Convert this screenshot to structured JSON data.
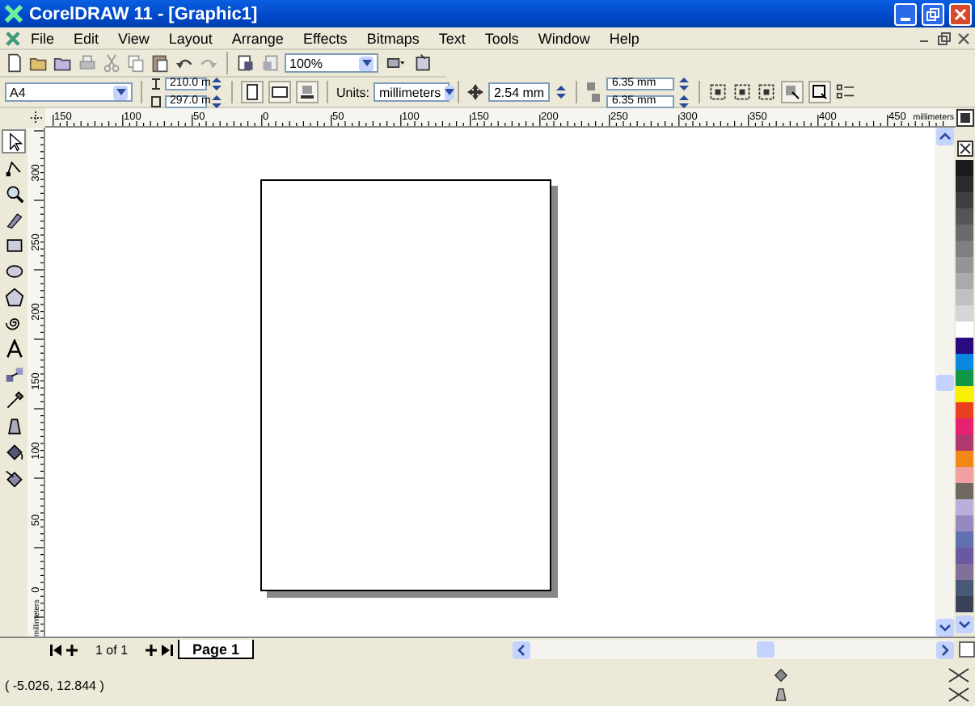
{
  "window": {
    "title": "CorelDRAW 11 - [Graphic1]"
  },
  "menu": [
    {
      "label": "File"
    },
    {
      "label": "Edit"
    },
    {
      "label": "View"
    },
    {
      "label": "Layout"
    },
    {
      "label": "Arrange"
    },
    {
      "label": "Effects"
    },
    {
      "label": "Bitmaps"
    },
    {
      "label": "Text"
    },
    {
      "label": "Tools"
    },
    {
      "label": "Window"
    },
    {
      "label": "Help"
    }
  ],
  "standard_toolbar": {
    "zoom": "100%"
  },
  "property_bar": {
    "paper": "A4",
    "width": "210.0 m",
    "height": "297.0 m",
    "units_label": "Units:",
    "units": "millimeters",
    "nudge": "2.54 mm",
    "duplicate_x": "6.35 mm",
    "duplicate_y": "6.35 mm"
  },
  "horizontal_ruler": {
    "labels": [
      "150",
      "100",
      "50",
      "0",
      "50",
      "100",
      "150",
      "200",
      "250",
      "300",
      "350",
      "400",
      "450"
    ],
    "unit": "millimeters"
  },
  "vertical_ruler": {
    "labels": [
      "300",
      "250",
      "200",
      "150",
      "100",
      "50",
      "0"
    ],
    "unit": "millimeters"
  },
  "toolbox": [
    {
      "selected": true
    },
    {
      "selected": false
    },
    {
      "selected": false
    },
    {
      "selected": false
    },
    {
      "selected": false
    },
    {
      "selected": false
    },
    {
      "selected": false
    },
    {
      "selected": false
    },
    {
      "selected": false
    },
    {
      "selected": false
    },
    {
      "selected": false
    },
    {
      "selected": false
    },
    {
      "selected": false
    },
    {
      "selected": false
    }
  ],
  "palette": [
    {
      "color": "#1a1a1a"
    },
    {
      "color": "#2b2b2b"
    },
    {
      "color": "#404040"
    },
    {
      "color": "#555555"
    },
    {
      "color": "#6a6a6a"
    },
    {
      "color": "#7f7f7f"
    },
    {
      "color": "#959595"
    },
    {
      "color": "#aaaaaa"
    },
    {
      "color": "#c0c0c0"
    },
    {
      "color": "#d6d6d6"
    },
    {
      "color": "#ffffff"
    },
    {
      "color": "#2a0a80"
    },
    {
      "color": "#0a88e0"
    },
    {
      "color": "#109848"
    },
    {
      "color": "#f8f000"
    },
    {
      "color": "#e84020"
    },
    {
      "color": "#e82070"
    },
    {
      "color": "#b03870"
    },
    {
      "color": "#f08818"
    },
    {
      "color": "#f0a0a0"
    },
    {
      "color": "#6e6860"
    },
    {
      "color": "#b8b0d8"
    },
    {
      "color": "#9888c0"
    },
    {
      "color": "#6070b0"
    },
    {
      "color": "#6a58a0"
    },
    {
      "color": "#80709a"
    },
    {
      "color": "#4a5878"
    },
    {
      "color": "#3a4058"
    }
  ],
  "page_navigator": {
    "counter": "1 of 1",
    "tabs": [
      {
        "label": "Page 1",
        "selected": true
      }
    ]
  },
  "status_bar": {
    "coordinates": "( -5.026, 12.844 )"
  }
}
